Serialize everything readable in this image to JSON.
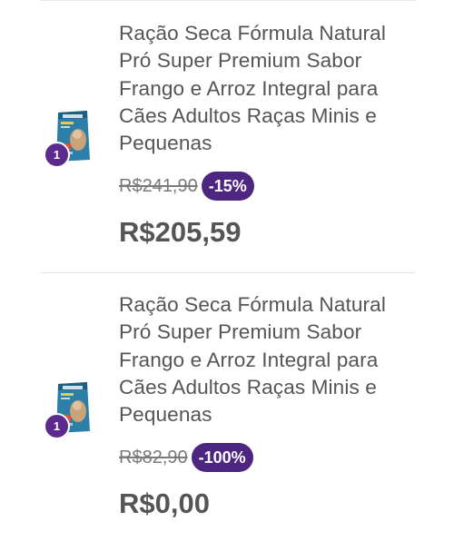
{
  "cart": {
    "items": [
      {
        "title": "Ração Seca Fórmula Natural Pró Super Premium Sabor Frango e Arroz Integral para Cães Adultos Raças Minis e Pequenas",
        "quantity": "1",
        "old_price": "R$241,90",
        "discount": "-15%",
        "price": "R$205,59",
        "thumbnail_icon": "dog-food-bag-icon"
      },
      {
        "title": "Ração Seca Fórmula Natural Pró Super Premium Sabor Frango e Arroz Integral para Cães Adultos Raças Minis e Pequenas",
        "quantity": "1",
        "old_price": "R$82,90",
        "discount": "-100%",
        "price": "R$0,00",
        "thumbnail_icon": "dog-food-bag-icon"
      }
    ]
  },
  "colors": {
    "discount_badge": "#4d2681",
    "quantity_badge": "#5b2a8c",
    "text": "#555555",
    "bag_primary": "#2b7fa8"
  }
}
